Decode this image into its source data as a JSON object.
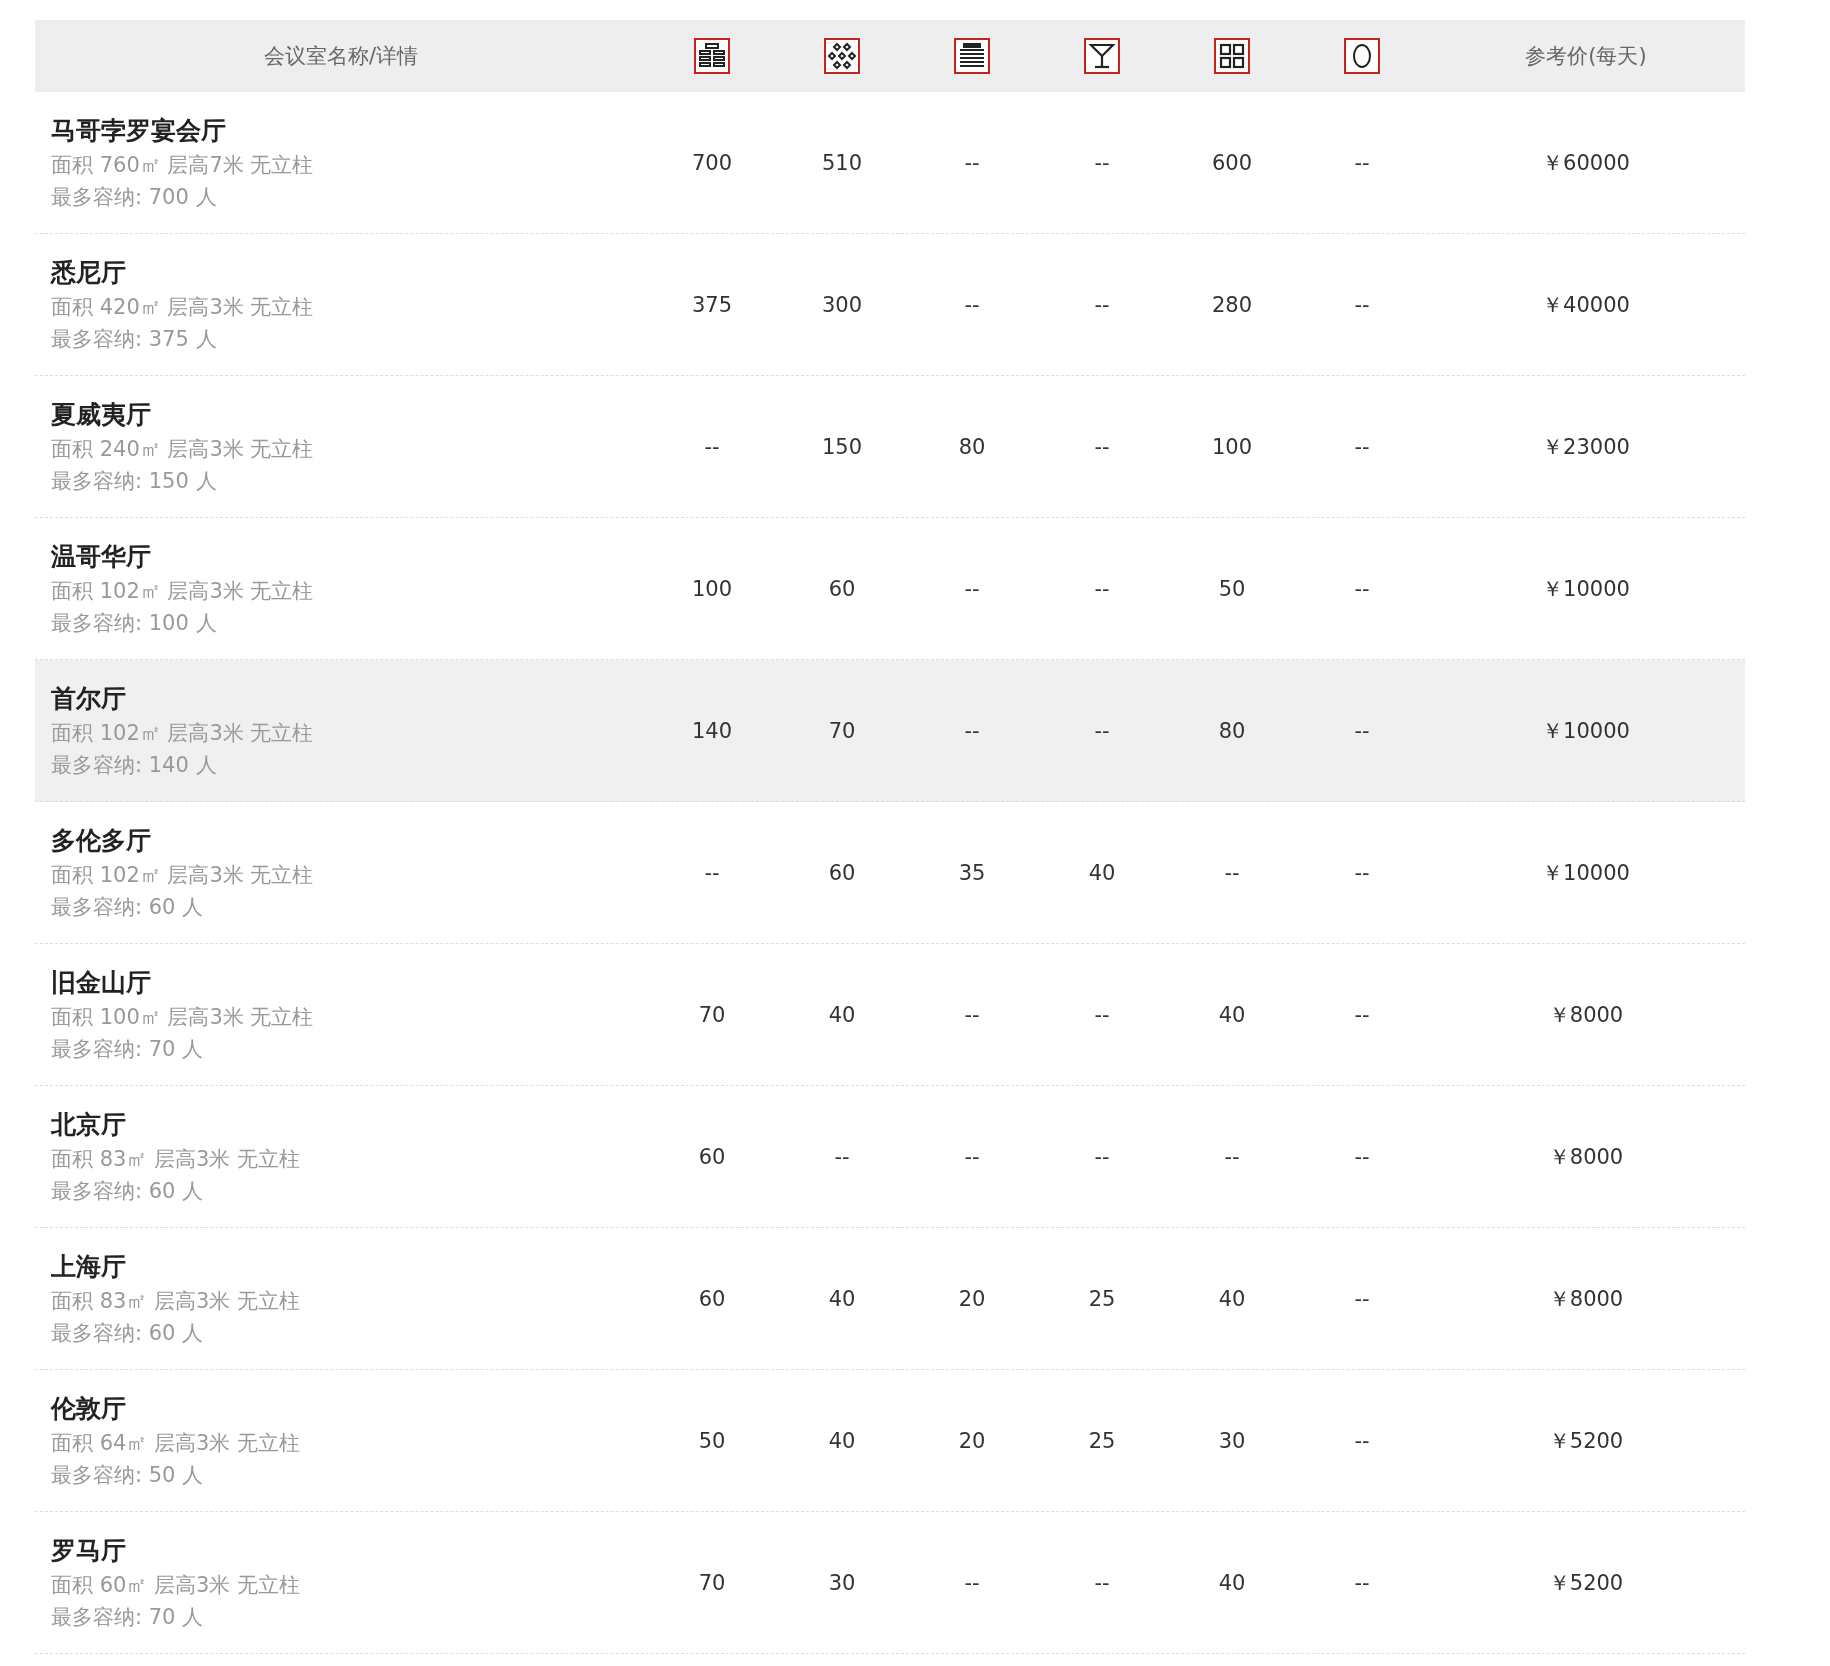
{
  "table": {
    "columns": [
      "会议室名称/详情",
      "参考价(每天)"
    ],
    "rows": [
      {
        "name": "马哥孛罗宴会厅",
        "details": "面积 760㎡ 层高7米 无立柱",
        "capacity": "最多容纳: 700 人",
        "values": [
          "700",
          "510",
          "--",
          "--",
          "600",
          "--"
        ],
        "price": "￥60000",
        "selected": false
      },
      {
        "name": "悉尼厅",
        "details": "面积 420㎡ 层高3米 无立柱",
        "capacity": "最多容纳: 375 人",
        "values": [
          "375",
          "300",
          "--",
          "--",
          "280",
          "--"
        ],
        "price": "￥40000",
        "selected": false
      },
      {
        "name": "夏威夷厅",
        "details": "面积 240㎡ 层高3米 无立柱",
        "capacity": "最多容纳: 150 人",
        "values": [
          "--",
          "150",
          "80",
          "--",
          "100",
          "--"
        ],
        "price": "￥23000",
        "selected": false
      },
      {
        "name": "温哥华厅",
        "details": "面积 102㎡ 层高3米 无立柱",
        "capacity": "最多容纳: 100 人",
        "values": [
          "100",
          "60",
          "--",
          "--",
          "50",
          "--"
        ],
        "price": "￥10000",
        "selected": false
      },
      {
        "name": "首尔厅",
        "details": "面积 102㎡ 层高3米 无立柱",
        "capacity": "最多容纳: 140 人",
        "values": [
          "140",
          "70",
          "--",
          "--",
          "80",
          "--"
        ],
        "price": "￥10000",
        "selected": true
      },
      {
        "name": "多伦多厅",
        "details": "面积 102㎡ 层高3米 无立柱",
        "capacity": "最多容纳: 60 人",
        "values": [
          "--",
          "60",
          "35",
          "40",
          "--",
          "--"
        ],
        "price": "￥10000",
        "selected": false
      },
      {
        "name": "旧金山厅",
        "details": "面积 100㎡ 层高3米 无立柱",
        "capacity": "最多容纳: 70 人",
        "values": [
          "70",
          "40",
          "--",
          "--",
          "40",
          "--"
        ],
        "price": "￥8000",
        "selected": false
      },
      {
        "name": "北京厅",
        "details": "面积 83㎡ 层高3米 无立柱",
        "capacity": "最多容纳: 60 人",
        "values": [
          "60",
          "--",
          "--",
          "--",
          "--",
          "--"
        ],
        "price": "￥8000",
        "selected": false
      },
      {
        "name": "上海厅",
        "details": "面积 83㎡ 层高3米 无立柱",
        "capacity": "最多容纳: 60 人",
        "values": [
          "60",
          "40",
          "20",
          "25",
          "40",
          "--"
        ],
        "price": "￥8000",
        "selected": false
      },
      {
        "name": "伦敦厅",
        "details": "面积 64㎡ 层高3米 无立柱",
        "capacity": "最多容纳: 50 人",
        "values": [
          "50",
          "40",
          "20",
          "25",
          "30",
          "--"
        ],
        "price": "￥5200",
        "selected": false
      },
      {
        "name": "罗马厅",
        "details": "面积 60㎡ 层高3米 无立柱",
        "capacity": "最多容纳: 70 人",
        "values": [
          "70",
          "30",
          "--",
          "--",
          "40",
          "--"
        ],
        "price": "￥5200",
        "selected": false
      }
    ]
  }
}
